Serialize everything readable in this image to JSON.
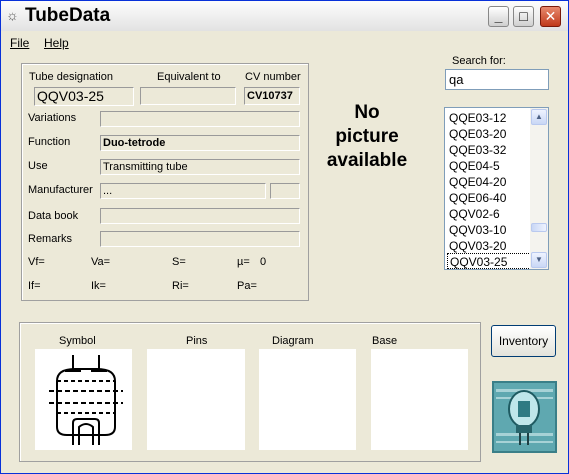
{
  "window": {
    "title": "TubeData",
    "icon": "bulb-icon"
  },
  "menu": [
    {
      "label": "File"
    },
    {
      "label": "Help"
    }
  ],
  "details": {
    "tube_designation_label": "Tube designation",
    "equivalent_label": "Equivalent to",
    "cv_label": "CV number",
    "tube_designation": "QQV03-25",
    "equivalent": "",
    "cv_number": "CV10737",
    "variations_label": "Variations",
    "variations": "",
    "function_label": "Function",
    "function": "Duo-tetrode",
    "use_label": "Use",
    "use": "Transmitting tube",
    "manufacturer_label": "Manufacturer",
    "manufacturer": "...",
    "manufacturer_extra": "",
    "databook_label": "Data book",
    "databook": "",
    "remarks_label": "Remarks",
    "remarks": "",
    "params": {
      "vf": "Vf=",
      "va": "Va=",
      "s": "S=",
      "mu": "µ=",
      "mu_value": "0",
      "if": "If=",
      "ik": "Ik=",
      "ri": "Ri=",
      "pa": "Pa="
    }
  },
  "picture_message": {
    "line1": "No",
    "line2": "picture",
    "line3": "available"
  },
  "search": {
    "label": "Search for:",
    "value": "qa",
    "results": [
      "QQE03-12",
      "QQE03-20",
      "QQE03-32",
      "QQE04-5",
      "QQE04-20",
      "QQE06-40",
      "QQV02-6",
      "QQV03-10",
      "QQV03-20",
      "QQV03-25"
    ],
    "selected": "QQV03-25"
  },
  "bottom": {
    "symbol_label": "Symbol",
    "pins_label": "Pins",
    "diagram_label": "Diagram",
    "base_label": "Base"
  },
  "inventory_label": "Inventory",
  "colors": {
    "titlebar_close": "#c0391a",
    "selection_border": "#000000",
    "list_border": "#7f9db9"
  }
}
